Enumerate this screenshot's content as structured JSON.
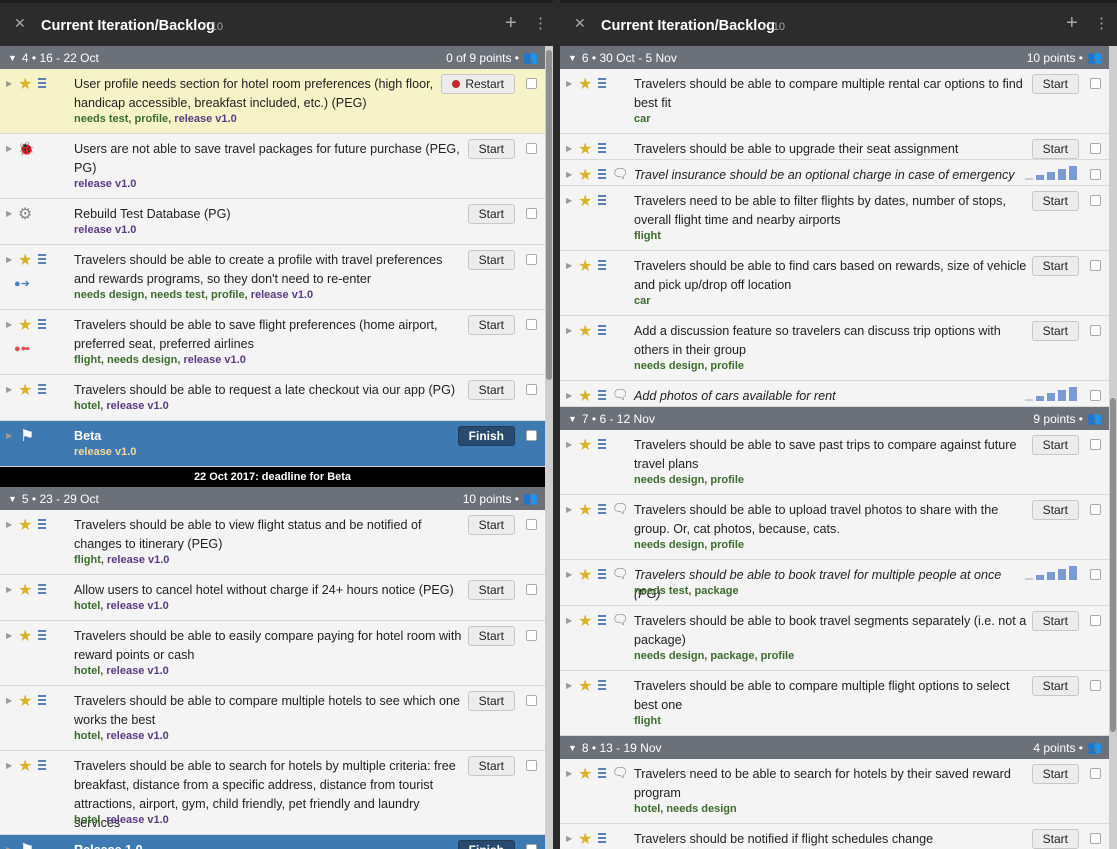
{
  "panels": [
    {
      "title": "Current Iteration/Backlog",
      "count": "10",
      "sections": [
        {
          "kind": "iter",
          "label": "4 • 16 - 22 Oct",
          "points": "0 of 9 points •"
        },
        {
          "kind": "story",
          "title": "User profile needs section for hotel room preferences (high floor, handicap accessible, breakfast included, etc.) (PEG)",
          "labels": [
            "needs test",
            "profile",
            "release v1.0"
          ],
          "btn": "Restart",
          "h": 65,
          "hl": true,
          "icon": "star"
        },
        {
          "kind": "story",
          "title": "Users are not able to save travel packages for future purchase (PEG, PG)",
          "labels": [
            "release v1.0"
          ],
          "btn": "Start",
          "h": 65,
          "icon": "bug"
        },
        {
          "kind": "story",
          "title": "Rebuild Test Database (PG)",
          "labels": [
            "release v1.0"
          ],
          "btn": "Start",
          "h": 46,
          "icon": "gear"
        },
        {
          "kind": "story",
          "title": "Travelers should be able to create a profile with travel preferences and rewards programs, so they don't need to re-enter",
          "labels": [
            "needs design",
            "needs test",
            "profile",
            "release v1.0"
          ],
          "btn": "Start",
          "h": 65,
          "icon": "star",
          "blocker": "blue"
        },
        {
          "kind": "story",
          "title": "Travelers should be able to save flight preferences (home airport, preferred seat, preferred airlines",
          "labels": [
            "flight",
            "needs design",
            "release v1.0"
          ],
          "btn": "Start",
          "h": 65,
          "icon": "star",
          "blocker": "red"
        },
        {
          "kind": "story",
          "title": "Travelers should be able to request a late checkout via our app (PG)",
          "labels": [
            "hotel",
            "release v1.0"
          ],
          "btn": "Start",
          "h": 46,
          "icon": "star"
        },
        {
          "kind": "release",
          "title": "Beta",
          "labels": [
            "release v1.0"
          ],
          "btn": "Finish",
          "h": 46
        },
        {
          "kind": "deadline",
          "label": "22 Oct 2017: deadline for Beta"
        },
        {
          "kind": "iter",
          "label": "5 • 23 - 29 Oct",
          "points": "10 points •"
        },
        {
          "kind": "story",
          "title": "Travelers should be able to view flight status and be notified of changes to itinerary (PEG)",
          "labels": [
            "flight",
            "release v1.0"
          ],
          "btn": "Start",
          "h": 65,
          "icon": "star"
        },
        {
          "kind": "story",
          "title": "Allow users to cancel hotel without charge if 24+ hours notice (PEG)",
          "labels": [
            "hotel",
            "release v1.0"
          ],
          "btn": "Start",
          "h": 46,
          "icon": "star"
        },
        {
          "kind": "story",
          "title": "Travelers should be able to easily compare paying for hotel room with reward points or cash",
          "labels": [
            "hotel",
            "release v1.0"
          ],
          "btn": "Start",
          "h": 65,
          "icon": "star"
        },
        {
          "kind": "story",
          "title": "Travelers should be able to compare multiple hotels to see which one works the best",
          "labels": [
            "hotel",
            "release v1.0"
          ],
          "btn": "Start",
          "h": 65,
          "icon": "star"
        },
        {
          "kind": "story",
          "title": "Travelers should be able to search for hotels by multiple criteria: free breakfast, distance from a specific address, distance from tourist attractions, airport, gym, child friendly, pet friendly and laundry services",
          "labels": [
            "hotel",
            "release v1.0"
          ],
          "btn": "Start",
          "h": 84,
          "icon": "star"
        },
        {
          "kind": "release",
          "title": "Release 1.0",
          "labels": [],
          "btn": "Finish",
          "h": 46
        }
      ]
    },
    {
      "title": "Current Iteration/Backlog",
      "count": "10",
      "sections": [
        {
          "kind": "iter",
          "label": "6 • 30 Oct - 5 Nov",
          "points": "10 points •"
        },
        {
          "kind": "story",
          "title": "Travelers should be able to compare multiple rental car options to find best fit",
          "labels": [
            "car"
          ],
          "btn": "Start",
          "h": 65,
          "icon": "star"
        },
        {
          "kind": "story",
          "title": "Travelers should be able to upgrade their seat assignment",
          "labels": [],
          "btn": "Start",
          "h": 26,
          "icon": "star"
        },
        {
          "kind": "story",
          "title": "Travel insurance should be an optional charge in case of emergency",
          "labels": [],
          "btn": "",
          "est": true,
          "italic": true,
          "h": 26,
          "icon": "star",
          "comment": true
        },
        {
          "kind": "story",
          "title": "Travelers need to be able to filter flights by dates, number of stops, overall flight time and nearby airports",
          "labels": [
            "flight"
          ],
          "btn": "Start",
          "h": 65,
          "icon": "star"
        },
        {
          "kind": "story",
          "title": "Travelers should be able to find cars based on rewards, size of vehicle and pick up/drop off location",
          "labels": [
            "car"
          ],
          "btn": "Start",
          "h": 65,
          "icon": "star"
        },
        {
          "kind": "story",
          "title": "Add a discussion feature so travelers can discuss trip options with others in their group",
          "labels": [
            "needs design",
            "profile"
          ],
          "btn": "Start",
          "h": 65,
          "icon": "star"
        },
        {
          "kind": "story",
          "title": "Add photos of cars available for rent",
          "labels": [],
          "btn": "",
          "est": true,
          "italic": true,
          "h": 26,
          "icon": "star",
          "comment": true
        },
        {
          "kind": "iter",
          "label": "7 • 6 - 12 Nov",
          "points": "9 points •"
        },
        {
          "kind": "story",
          "title": "Travelers should be able to save past trips to compare against future travel plans",
          "labels": [
            "needs design",
            "profile"
          ],
          "btn": "Start",
          "h": 65,
          "icon": "star"
        },
        {
          "kind": "story",
          "title": "Travelers should be able to upload travel photos to share with the group. Or, cat photos, because, cats.",
          "labels": [
            "needs design",
            "profile"
          ],
          "btn": "Start",
          "h": 65,
          "icon": "star",
          "comment": true
        },
        {
          "kind": "story",
          "title": "Travelers should be able to book travel for multiple people at once (PG)",
          "labels": [
            "needs test",
            "package"
          ],
          "btn": "",
          "est": true,
          "italic": true,
          "h": 46,
          "icon": "star",
          "comment": true
        },
        {
          "kind": "story",
          "title": "Travelers should be able to book travel segments separately (i.e. not a package)",
          "labels": [
            "needs design",
            "package",
            "profile"
          ],
          "btn": "Start",
          "h": 65,
          "icon": "star",
          "comment": true
        },
        {
          "kind": "story",
          "title": "Travelers should be able to compare multiple flight options to select best one",
          "labels": [
            "flight"
          ],
          "btn": "Start",
          "h": 65,
          "icon": "star"
        },
        {
          "kind": "iter",
          "label": "8 • 13 - 19 Nov",
          "points": "4 points •"
        },
        {
          "kind": "story",
          "title": "Travelers need to be able to search for hotels by their saved reward program",
          "labels": [
            "hotel",
            "needs design"
          ],
          "btn": "Start",
          "h": 65,
          "icon": "star",
          "comment": true
        },
        {
          "kind": "story",
          "title": "Travelers should be notified if flight schedules change",
          "labels": [],
          "btn": "Start",
          "h": 40,
          "icon": "star"
        }
      ]
    }
  ],
  "colors": {
    "release": "#3f79b1",
    "iteration_header": "#6c7079",
    "highlight": "#f7f3c8",
    "star": "#d9b22a"
  }
}
